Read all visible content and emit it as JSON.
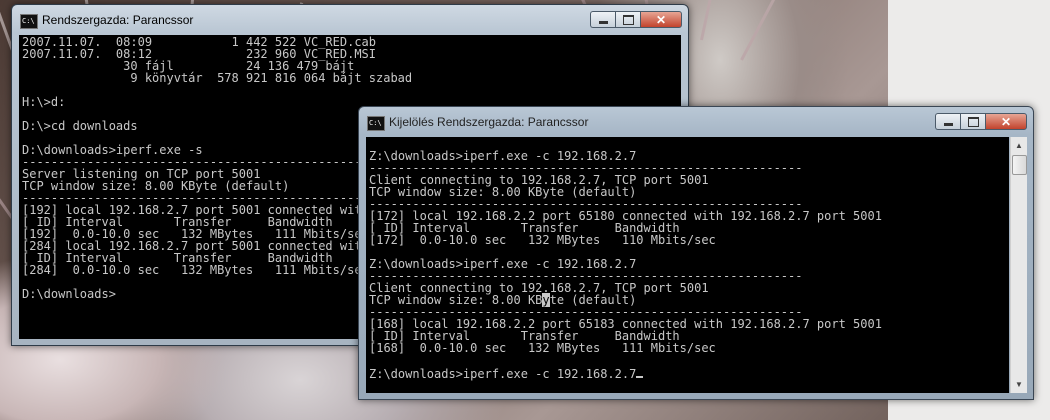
{
  "window_back": {
    "title": "Rendszergazda: Parancssor",
    "icon_label": "C:\\",
    "lines": [
      "2007.11.07.  08:09           1 442 522 VC_RED.cab",
      "2007.11.07.  08:12             232 960 VC_RED.MSI",
      "              30 fájl          24 136 479 bájt",
      "               9 könyvtár  578 921 816 064 bájt szabad",
      "",
      "H:\\>d:",
      "",
      "D:\\>cd downloads",
      "",
      "D:\\downloads>iperf.exe -s",
      "------------------------------------------------------------",
      "Server listening on TCP port 5001",
      "TCP window size: 8.00 KByte (default)",
      "------------------------------------------------------------",
      "[192] local 192.168.2.7 port 5001 connected with 192.168.2.2 port 65180",
      "[ ID] Interval       Transfer     Bandwidth",
      "[192]  0.0-10.0 sec   132 MBytes   111 Mbits/sec",
      "[284] local 192.168.2.7 port 5001 connected with 192.168.2.2 port 65183",
      "[ ID] Interval       Transfer     Bandwidth",
      "[284]  0.0-10.0 sec   132 MBytes   111 Mbits/sec",
      "",
      "D:\\downloads>"
    ]
  },
  "window_front": {
    "title": "Kijelölés Rendszergazda: Parancssor",
    "icon_label": "C:\\",
    "lines": [
      "",
      "Z:\\downloads>iperf.exe -c 192.168.2.7",
      "------------------------------------------------------------",
      "Client connecting to 192.168.2.7, TCP port 5001",
      "TCP window size: 8.00 KByte (default)",
      "------------------------------------------------------------",
      "[172] local 192.168.2.2 port 65180 connected with 192.168.2.7 port 5001",
      "[ ID] Interval       Transfer     Bandwidth",
      "[172]  0.0-10.0 sec   132 MBytes   110 Mbits/sec",
      "",
      "Z:\\downloads>iperf.exe -c 192.168.2.7",
      "------------------------------------------------------------",
      "Client connecting to 192.168.2.7, TCP port 5001",
      "TCP window size: 8.00 KByte (default)",
      "------------------------------------------------------------",
      "[168] local 192.168.2.2 port 65183 connected with 192.168.2.7 port 5001",
      "[ ID] Interval       Transfer     Bandwidth",
      "[168]  0.0-10.0 sec   132 MBytes   111 Mbits/sec",
      "",
      "Z:\\downloads>iperf.exe -c 192.168.2.7"
    ],
    "selection_line": 13,
    "selection_char": 24
  },
  "caption_buttons": {
    "minimize": "minimize-icon",
    "maximize": "maximize-icon",
    "close": "close-icon",
    "close_glyph": "✕"
  },
  "colors": {
    "console_bg": "#000000",
    "console_fg": "#c8c8c8",
    "close_red": "#c2432d"
  }
}
